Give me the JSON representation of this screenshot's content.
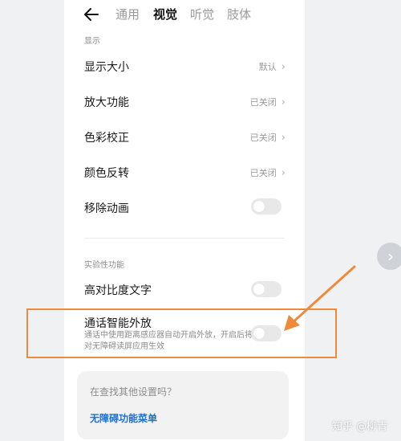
{
  "header": {
    "back_icon": "back-arrow-icon",
    "tabs": [
      {
        "label": "通用",
        "active": false
      },
      {
        "label": "视觉",
        "active": true
      },
      {
        "label": "听觉",
        "active": false
      },
      {
        "label": "肢体",
        "active": false
      }
    ]
  },
  "display_section": {
    "label": "显示",
    "rows": [
      {
        "title": "显示大小",
        "value": "默认"
      },
      {
        "title": "放大功能",
        "value": "已关闭"
      },
      {
        "title": "色彩校正",
        "value": "已关闭"
      },
      {
        "title": "颜色反转",
        "value": "已关闭"
      },
      {
        "title": "移除动画",
        "toggle": false
      }
    ]
  },
  "experimental_section": {
    "label": "实验性功能",
    "rows": [
      {
        "title": "高对比度文字",
        "toggle": false
      },
      {
        "title": "通话智能外放",
        "description": "通话中使用距离感应器自动开启外放，开启后将对无障碍读屏应用生效",
        "toggle": false
      }
    ]
  },
  "help_card": {
    "question": "在查找其他设置吗？",
    "link": "无障碍功能菜单"
  },
  "annotation": {
    "highlight_color": "#f08a3a",
    "arrow_color": "#f08a3a"
  },
  "side_button": {
    "icon": "chevron-right-icon",
    "glyph": "›"
  },
  "watermark": "知乎 @柳青",
  "colors": {
    "accent_link": "#1f6fd8",
    "toggle_off": "#e8e8e8"
  }
}
